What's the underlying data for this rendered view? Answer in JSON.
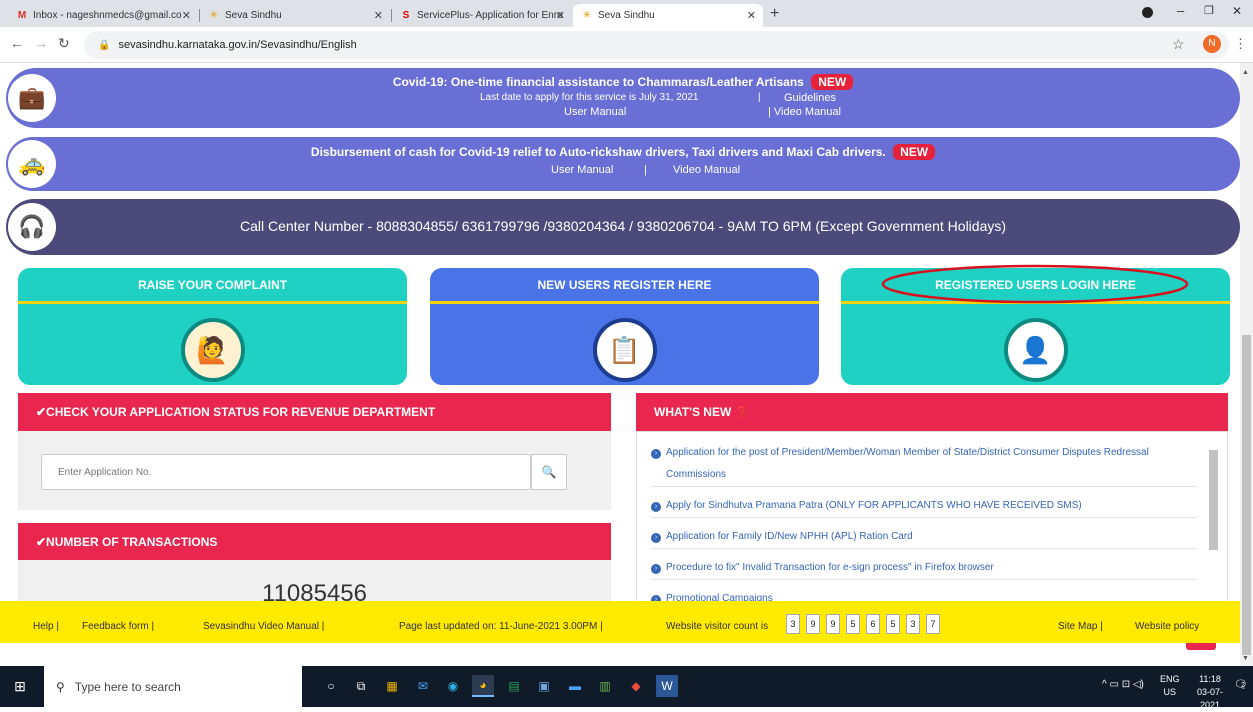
{
  "browser": {
    "tabs": [
      {
        "title": "Inbox - nageshnmedcs@gmail.co",
        "icon": "gmail-icon"
      },
      {
        "title": "Seva Sindhu",
        "icon": "seva-sindhu-icon"
      },
      {
        "title": "ServicePlus- Application for Enro",
        "icon": "serviceplus-icon"
      },
      {
        "title": "Seva Sindhu",
        "icon": "seva-sindhu-icon"
      }
    ],
    "url": "sevasindhu.karnataka.gov.in/Sevasindhu/English",
    "profile_initial": "N"
  },
  "banners": {
    "b1": {
      "title": "Covid-19: One-time financial assistance to Chammaras/Leather Artisans",
      "badge": "NEW",
      "line2a": "Last date to apply for this service is July 31, 2021",
      "sep": "|",
      "line2b": "Guidelines",
      "line3a": "User Manual",
      "line3b": "| Video Manual"
    },
    "b2": {
      "title": "Disbursement of cash for Covid-19 relief to Auto-rickshaw drivers, Taxi drivers and Maxi Cab drivers.",
      "badge": "NEW",
      "line2a": "User Manual",
      "sep": "|",
      "line2b": "Video Manual"
    },
    "call": "Call Center Number - 8088304855/ 6361799796 /9380204364 / 9380206704 - 9AM TO 6PM (Except Government Holidays)"
  },
  "cards": {
    "complaint": "RAISE YOUR COMPLAINT",
    "register": "NEW USERS REGISTER HERE",
    "login": "REGISTERED USERS LOGIN HERE"
  },
  "status": {
    "header": "✔CHECK YOUR APPLICATION STATUS FOR REVENUE DEPARTMENT",
    "placeholder": "Enter Application No."
  },
  "transactions": {
    "header": "✔NUMBER OF TRANSACTIONS",
    "count": "11085456"
  },
  "whats_new": {
    "header": "WHAT'S NEW",
    "items": [
      "Application for the post of President/Member/Woman Member of State/District Consumer Disputes Redressal",
      "Commissions",
      "Apply for Sindhutva Pramana Patra (ONLY FOR APPLICANTS WHO HAVE RECEIVED SMS)",
      "Application for Family ID/New NPHH (APL) Ration Card",
      "Procedure to fix\" Invalid Transaction for e-sign process\" in Firefox browser",
      "Promotional Campaigns"
    ]
  },
  "footer": {
    "help": "Help |",
    "feedback": "Feedback form |",
    "video_manual": "Sevasindhu Video Manual |",
    "updated": "Page last updated on: 11-June-2021 3.00PM |",
    "visitor_label": "Website visitor count is",
    "visitor_digits": [
      "3",
      "9",
      "9",
      "5",
      "6",
      "5",
      "3",
      "7"
    ],
    "sitemap": "Site Map |",
    "policy": "Website policy"
  },
  "taskbar": {
    "search_placeholder": "Type here to search",
    "lang": "ENG",
    "region": "US",
    "time": "11:18",
    "date": "03-07-2021",
    "notification_count": "2"
  },
  "colors": {
    "banner_purple": "#6a6fd5",
    "banner_dark": "#4c4a7a",
    "teal": "#1fd1c3",
    "blue": "#4a73e8",
    "red": "#e8264e",
    "yellow": "#ffea00",
    "highlight_ellipse": "#d6121f"
  }
}
